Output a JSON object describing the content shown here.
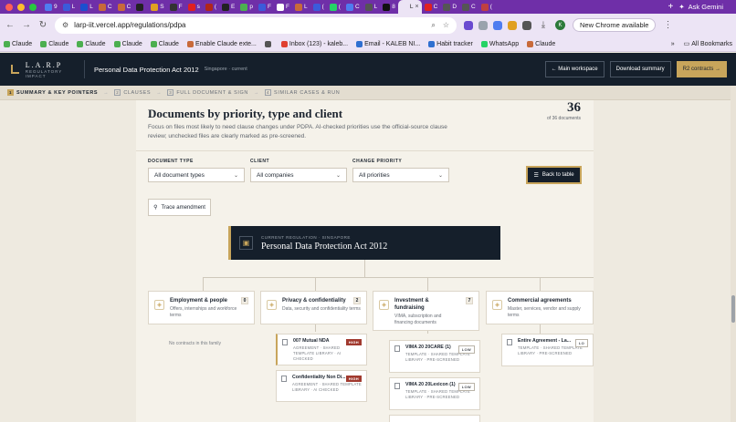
{
  "browser": {
    "tabs": [
      {
        "label": "9",
        "color": "#4f7df0"
      },
      {
        "label": "L",
        "color": "#3b5bdb"
      },
      {
        "label": "L",
        "color": "#1b4fcf"
      },
      {
        "label": "C",
        "color": "#c86a3a"
      },
      {
        "label": "C",
        "color": "#c86a3a"
      },
      {
        "label": "",
        "color": "#222222"
      },
      {
        "label": "S",
        "color": "#e0a020"
      },
      {
        "label": "F",
        "color": "#333333"
      },
      {
        "label": "s",
        "color": "#e02020"
      },
      {
        "label": "(",
        "color": "#b1261a"
      },
      {
        "label": "E",
        "color": "#222222"
      },
      {
        "label": "p",
        "color": "#4caf50"
      },
      {
        "label": "F",
        "color": "#3b5bdb"
      },
      {
        "label": "F",
        "color": "#ffffff"
      },
      {
        "label": "L",
        "color": "#c86a3a"
      },
      {
        "label": "(",
        "color": "#3b5bdb"
      },
      {
        "label": "(",
        "color": "#25d366"
      },
      {
        "label": "C",
        "color": "#4f7df0"
      },
      {
        "label": "L",
        "color": "#555555"
      },
      {
        "label": "8",
        "color": "#111111"
      },
      {
        "label": "L",
        "color": "#ece4f5",
        "active": true
      },
      {
        "label": "C",
        "color": "#e02020"
      },
      {
        "label": "D",
        "color": "#555555"
      },
      {
        "label": "C",
        "color": "#555555"
      },
      {
        "label": "(",
        "color": "#c04040"
      }
    ],
    "newtab_icon": "+",
    "ask_gemini": "Ask Gemini",
    "url": "larp-iit.vercel.app/regulations/pdpa",
    "new_chrome": "New Chrome available",
    "profile_initial": "K",
    "bookmarks": [
      {
        "label": "Claude",
        "color": "#4caf50"
      },
      {
        "label": "Claude",
        "color": "#4caf50"
      },
      {
        "label": "Claude",
        "color": "#4caf50"
      },
      {
        "label": "Claude",
        "color": "#4caf50"
      },
      {
        "label": "Claude",
        "color": "#4caf50"
      },
      {
        "label": "Enable Claude exte...",
        "color": "#c86a3a"
      },
      {
        "label": "",
        "color": "#555555"
      },
      {
        "label": "Inbox (123) - kaleb...",
        "color": "#e04030"
      },
      {
        "label": "Email - KALEB NI...",
        "color": "#2f6fd0"
      },
      {
        "label": "Habit tracker",
        "color": "#2f6fd0"
      },
      {
        "label": "WhatsApp",
        "color": "#25d366"
      },
      {
        "label": "Claude",
        "color": "#c86a3a"
      }
    ],
    "all_bookmarks": "All Bookmarks"
  },
  "app": {
    "logo": "L.A.R.P",
    "logo_sub": "REGULATORY IMPACT",
    "regulation_title": "Personal Data Protection Act 2012",
    "regulation_sub": "Singapore · current",
    "buttons": {
      "main_workspace": "← Main workspace",
      "download_summary": "Download summary",
      "r2_contracts": "R2 contracts →"
    },
    "steps": [
      {
        "num": "1",
        "label": "SUMMARY & KEY POINTERS",
        "active": true
      },
      {
        "num": "2",
        "label": "CLAUSES"
      },
      {
        "num": "3",
        "label": "FULL DOCUMENT & SIGN"
      },
      {
        "num": "4",
        "label": "SIMILAR CASES & RUN"
      }
    ]
  },
  "panel": {
    "title": "Documents by priority, type and client",
    "description": "Focus on files most likely to need clause changes under PDPA. AI-checked priorities use the official-source clause review; unchecked files are clearly marked as pre-screened.",
    "count": "36",
    "count_label": "of 36 documents",
    "filters": [
      {
        "label": "DOCUMENT TYPE",
        "value": "All document types"
      },
      {
        "label": "CLIENT",
        "value": "All companies"
      },
      {
        "label": "CHANGE PRIORITY",
        "value": "All priorities"
      }
    ],
    "back_to_table": "Back to table",
    "trace_amendment": "Trace amendment",
    "regulation_node": {
      "sub": "CURRENT REGULATION · SINGAPORE",
      "title": "Personal Data Protection Act 2012"
    },
    "categories": [
      {
        "title": "Employment & people",
        "desc": "Offers, internships and workforce terms",
        "count": "0"
      },
      {
        "title": "Privacy & confidentiality",
        "desc": "Data, security and confidentiality terms",
        "count": "2"
      },
      {
        "title": "Investment & fundraising",
        "desc": "VIMA, subscription and financing documents",
        "count": "7"
      },
      {
        "title": "Commercial agreements",
        "desc": "Master, services, vendor and supply terms",
        "count": ""
      }
    ],
    "no_contracts": "No contracts in this family",
    "docs": {
      "privacy": [
        {
          "title": "007 Mutual NDA",
          "meta": "AGREEMENT · SHARED TEMPLATE LIBRARY · AI CHECKED",
          "badge": "HIGH"
        },
        {
          "title": "Confidentiality Non Di...",
          "meta": "AGREEMENT · SHARED TEMPLATE LIBRARY · AI CHECKED",
          "badge": "HIGH"
        }
      ],
      "investment": [
        {
          "title": "VIMA 20 20CARE (1)",
          "meta": "TEMPLATE · SHARED TEMPLATE LIBRARY · PRE-SCREENED",
          "badge": "LOW"
        },
        {
          "title": "VIMA 20 20Lexicon (1)",
          "meta": "TEMPLATE · SHARED TEMPLATE LIBRARY · PRE-SCREENED",
          "badge": "LOW"
        }
      ],
      "commercial": [
        {
          "title": "Entire Agreement - La...",
          "meta": "TEMPLATE · SHARED TEMPLATE LIBRARY · PRE-SCREENED",
          "badge": "LO"
        }
      ]
    }
  }
}
